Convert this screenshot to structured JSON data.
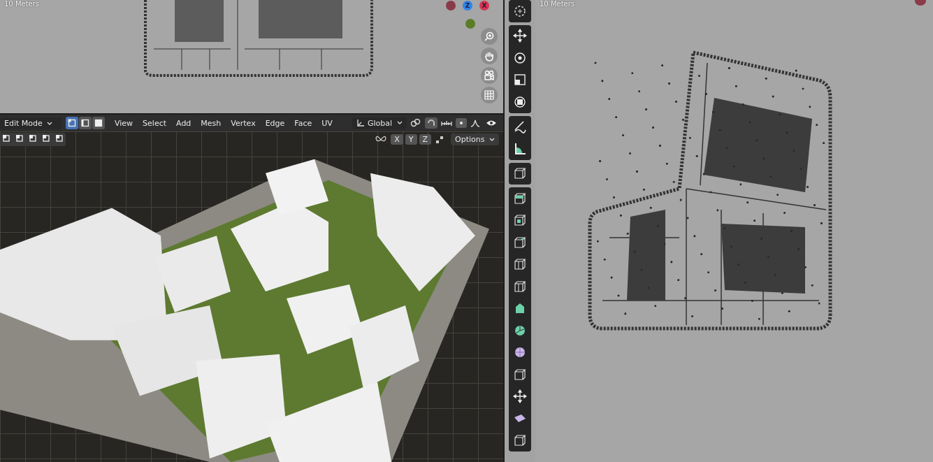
{
  "top_viewport": {
    "scale_label": "10 Meters",
    "gizmo": [
      {
        "label": "Z",
        "color": "#2f83e6"
      },
      {
        "label": "X",
        "color": "#d9344f"
      }
    ]
  },
  "header": {
    "mode": "Edit Mode",
    "select_modes": [
      {
        "selected": true
      },
      {
        "selected": false
      },
      {
        "selected": false
      }
    ],
    "menus": [
      "View",
      "Select",
      "Add",
      "Mesh",
      "Vertex",
      "Edge",
      "Face",
      "UV"
    ],
    "orientation": "Global",
    "proportional_on": true,
    "mirror_axes": [
      "X",
      "Y",
      "Z"
    ],
    "options": "Options"
  },
  "side_viewport": {
    "scale_label": "10 Meters"
  }
}
